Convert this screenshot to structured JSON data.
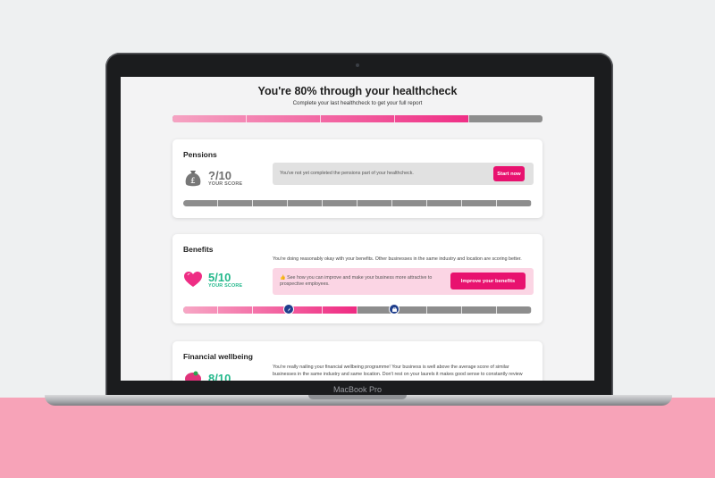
{
  "device": {
    "label": "MacBook Pro"
  },
  "page": {
    "title": "You're 80% through your healthcheck",
    "subtitle": "Complete your last healthcheck to get your full report",
    "progress_fraction": 0.8
  },
  "cards": {
    "pensions": {
      "title": "Pensions",
      "score": "?/10",
      "score_label": "YOUR SCORE",
      "icon": "money-bag-icon",
      "notice": "You've not yet completed the pensions part of your healthcheck.",
      "button": "Start now"
    },
    "benefits": {
      "title": "Benefits",
      "score": "5/10",
      "score_label": "YOUR SCORE",
      "icon": "heart-icon",
      "description": "You're doing reasonably okay with your benefits. Other businesses in the same industry and location are scoring better.",
      "notice": "👍 See how you can improve and make your business more attractive to prospective employees.",
      "button": "Improve your benefits",
      "score_fraction": 0.5
    },
    "financial_wellbeing": {
      "title": "Financial wellbeing",
      "score": "8/10",
      "icon": "piggy-bank-icon",
      "description": "You're really nailing your financial wellbeing programme! Your business is well above the average score of similar businesses in the same industry and same location. Don't rest on your laurels it makes good sense to constantly review"
    }
  },
  "colors": {
    "accent": "#e8126f",
    "score_good": "#23b88b",
    "marker": "#1f3e8c"
  }
}
